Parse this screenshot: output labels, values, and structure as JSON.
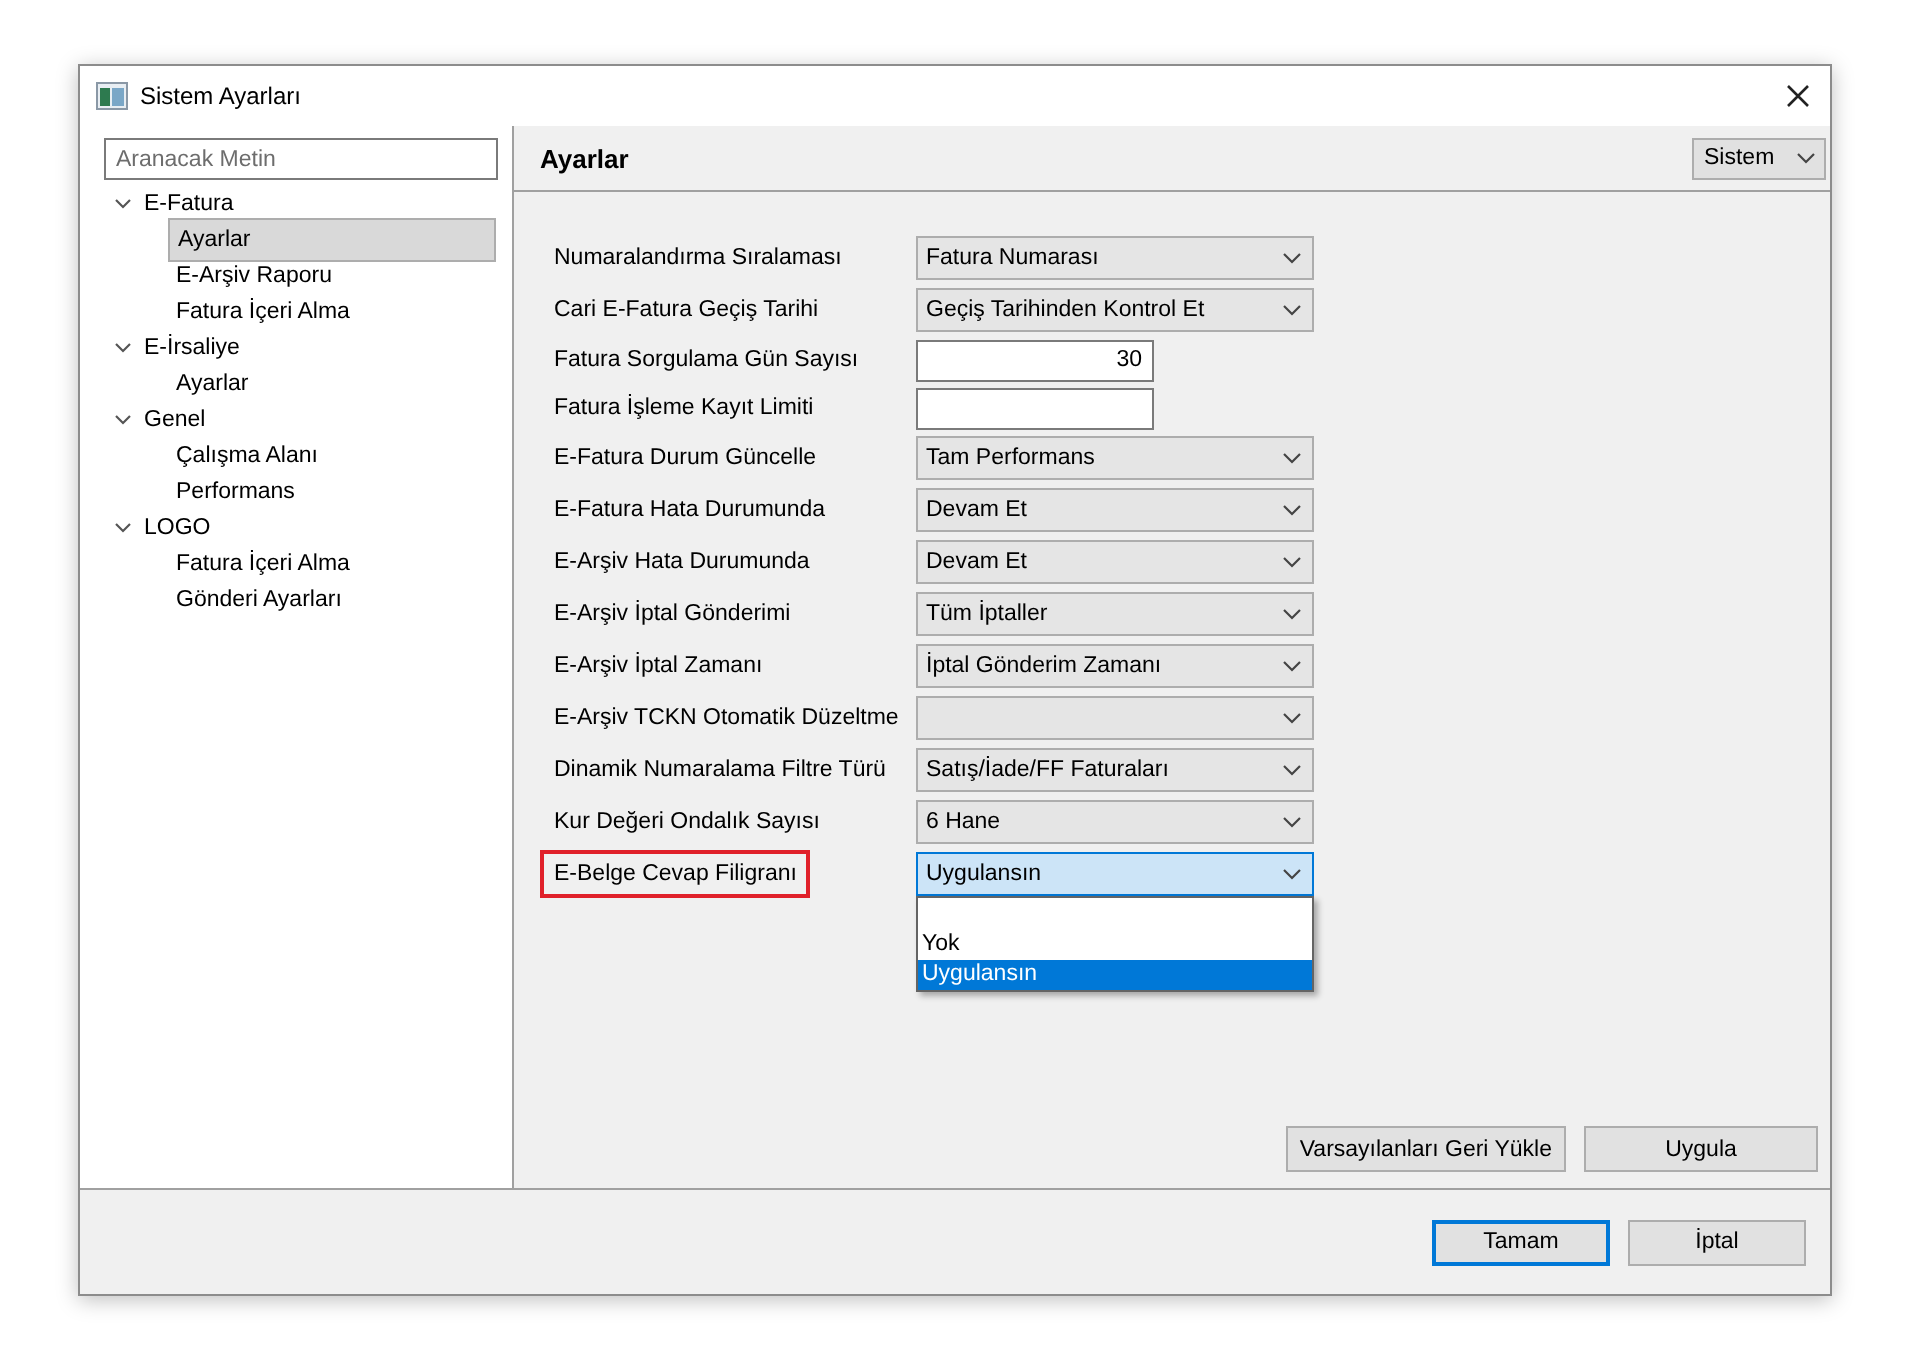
{
  "window": {
    "title": "Sistem Ayarları"
  },
  "search": {
    "placeholder": "Aranacak Metin"
  },
  "tree": [
    {
      "label": "E-Fatura",
      "expanded": true,
      "children": [
        {
          "label": "Ayarlar",
          "selected": true
        },
        {
          "label": "E-Arşiv Raporu",
          "selected": false
        },
        {
          "label": "Fatura İçeri Alma",
          "selected": false
        }
      ]
    },
    {
      "label": "E-İrsaliye",
      "expanded": true,
      "children": [
        {
          "label": "Ayarlar",
          "selected": false
        }
      ]
    },
    {
      "label": "Genel",
      "expanded": true,
      "children": [
        {
          "label": "Çalışma Alanı",
          "selected": false
        },
        {
          "label": "Performans",
          "selected": false
        }
      ]
    },
    {
      "label": "LOGO",
      "expanded": true,
      "children": [
        {
          "label": "Fatura İçeri Alma",
          "selected": false
        },
        {
          "label": "Gönderi Ayarları",
          "selected": false
        }
      ]
    }
  ],
  "header": {
    "title": "Ayarlar",
    "scope": "Sistem"
  },
  "settings": [
    {
      "label": "Numaralandırma Sıralaması",
      "kind": "select",
      "value": "Fatura Numarası"
    },
    {
      "label": "Cari E-Fatura Geçiş Tarihi",
      "kind": "select",
      "value": "Geçiş Tarihinden Kontrol Et"
    },
    {
      "label": "Fatura Sorgulama Gün Sayısı",
      "kind": "input",
      "value": "30"
    },
    {
      "label": "Fatura İşleme Kayıt Limiti",
      "kind": "input"
    },
    {
      "label": "E-Fatura Durum Güncelle",
      "kind": "select",
      "value": "Tam Performans"
    },
    {
      "label": "E-Fatura Hata Durumunda",
      "kind": "select",
      "value": "Devam Et"
    },
    {
      "label": "E-Arşiv Hata Durumunda",
      "kind": "select",
      "value": "Devam Et"
    },
    {
      "label": "E-Arşiv İptal Gönderimi",
      "kind": "select",
      "value": "Tüm İptaller"
    },
    {
      "label": "E-Arşiv İptal Zamanı",
      "kind": "select",
      "value": "İptal Gönderim Zamanı"
    },
    {
      "label": "E-Arşiv TCKN Otomatik Düzeltme",
      "kind": "select"
    },
    {
      "label": "Dinamik Numaralama Filtre Türü",
      "kind": "select",
      "value": "Satış/İade/FF Faturaları"
    },
    {
      "label": "Kur Değeri Ondalık Sayısı",
      "kind": "select",
      "value": "6 Hane"
    },
    {
      "label": "E-Belge Cevap Filigranı",
      "kind": "select",
      "value": "Uygulansın",
      "highlighted": true,
      "focused": true,
      "options": [
        {
          "label": "Yok",
          "selected": false
        },
        {
          "label": "Uygulansın",
          "selected": true
        }
      ]
    }
  ],
  "panel_buttons": [
    {
      "label": "Varsayılanları Geri Yükle",
      "default": false
    },
    {
      "label": "Uygula",
      "default": false
    }
  ],
  "dialog_buttons": [
    {
      "label": "Tamam",
      "default": true
    },
    {
      "label": "İptal",
      "default": false
    }
  ]
}
